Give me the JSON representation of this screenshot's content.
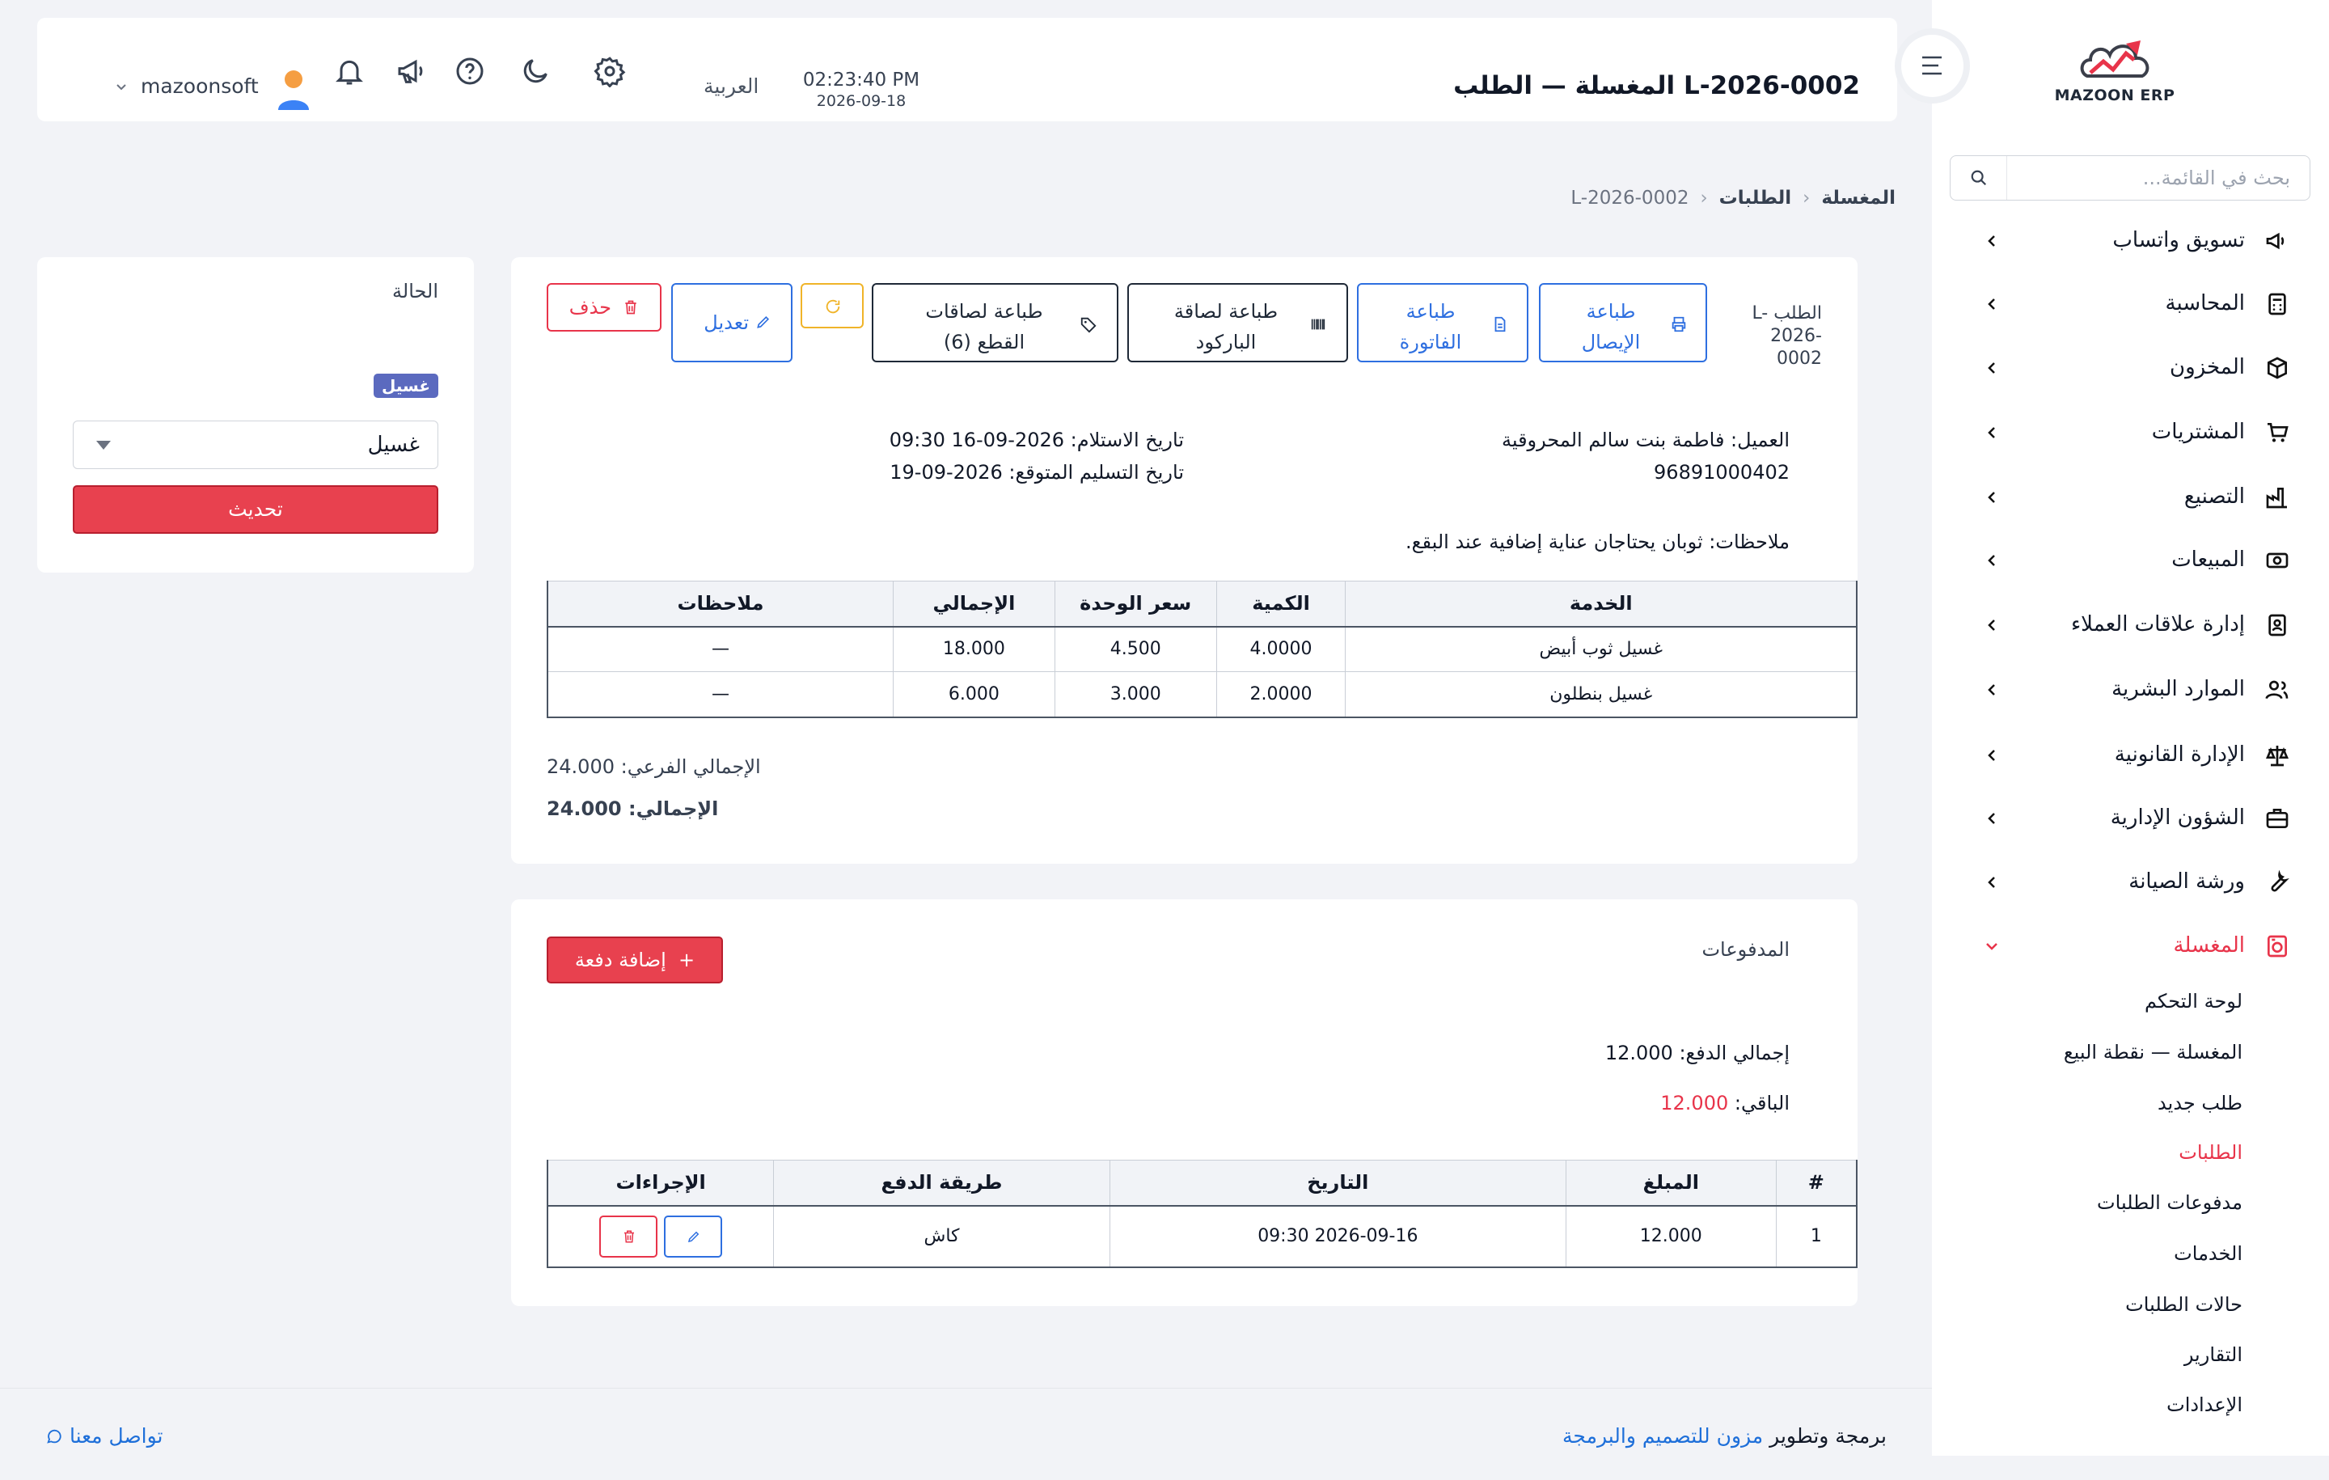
{
  "app": {
    "logo_text": "MAZOON ERP"
  },
  "sidebar": {
    "search_placeholder": "بحث في القائمة...",
    "items": [
      {
        "label": "تسويق واتساب",
        "icon": "megaphone-icon"
      },
      {
        "label": "المحاسبة",
        "icon": "calculator-icon"
      },
      {
        "label": "المخزون",
        "icon": "box-icon"
      },
      {
        "label": "المشتريات",
        "icon": "cart-icon"
      },
      {
        "label": "التصنيع",
        "icon": "factory-icon"
      },
      {
        "label": "المبيعات",
        "icon": "cash-icon"
      },
      {
        "label": "إدارة علاقات العملاء",
        "icon": "contact-book-icon"
      },
      {
        "label": "الموارد البشرية",
        "icon": "users-icon"
      },
      {
        "label": "الإدارة القانونية",
        "icon": "scale-icon"
      },
      {
        "label": "الشؤون الإدارية",
        "icon": "briefcase-icon"
      },
      {
        "label": "ورشة الصيانة",
        "icon": "wrench-icon"
      },
      {
        "label": "المغسلة",
        "icon": "washing-machine-icon",
        "active": true
      }
    ],
    "laundry_sub": [
      {
        "label": "لوحة التحكم"
      },
      {
        "label": "المغسلة — نقطة البيع"
      },
      {
        "label": "طلب جديد"
      },
      {
        "label": "الطلبات",
        "active": true
      },
      {
        "label": "مدفوعات الطلبات"
      },
      {
        "label": "الخدمات"
      },
      {
        "label": "حالات الطلبات"
      },
      {
        "label": "التقارير"
      },
      {
        "label": "الإعدادات"
      }
    ]
  },
  "header": {
    "title": "المغسلة — الطلب L-2026-0002",
    "time": "02:23:40 PM",
    "date": "2026-09-18",
    "language": "العربية",
    "username": "mazoonsoft"
  },
  "breadcrumb": {
    "root": "المغسلة",
    "section": "الطلبات",
    "current": "L-2026-0002"
  },
  "status_card": {
    "label": "الحالة",
    "badge": "غسيل",
    "badge_color": "#5b6abf",
    "selected": "غسيل",
    "update_button": "تحديث"
  },
  "order": {
    "label": "الطلب L-2026-0002",
    "actions": {
      "print_receipt": "طباعة الإيصال",
      "print_invoice": "طباعة الفاتورة",
      "print_barcode": "طباعة لصاقة الباركود",
      "print_labels": "طباعة لصاقات القطع (6)",
      "edit": "تعديل",
      "delete": "حذف"
    },
    "customer": "العميل: فاطمة بنت سالم المحروقية",
    "phone": "96891000402",
    "received": "تاريخ الاستلام: 2026-09-16 09:30",
    "expected": "تاريخ التسليم المتوقع: 2026-09-19",
    "notes": "ملاحظات: ثوبان يحتاجان عناية إضافية عند البقع.",
    "items_headers": [
      "الخدمة",
      "الكمية",
      "سعر الوحدة",
      "الإجمالي",
      "ملاحظات"
    ],
    "items": [
      [
        "غسيل ثوب أبيض",
        "4.0000",
        "4.500",
        "18.000",
        "—"
      ],
      [
        "غسيل بنطلون",
        "2.0000",
        "3.000",
        "6.000",
        "—"
      ]
    ],
    "subtotal": "الإجمالي الفرعي: 24.000",
    "total_label": "الإجمالي:",
    "total_value": "24.000"
  },
  "payments": {
    "title": "المدفوعات",
    "add_button": "إضافة دفعة",
    "paid_total": "إجمالي الدفع: 12.000",
    "remaining_label": "الباقي:",
    "remaining_value": "12.000",
    "remaining_color": "#e8344a",
    "headers": [
      "#",
      "المبلغ",
      "التاريخ",
      "طريقة الدفع",
      "الإجراءات"
    ],
    "rows": [
      [
        "1",
        "12.000",
        "2026-09-16 09:30",
        "كاش"
      ]
    ]
  },
  "footer": {
    "credit_prefix": "برمجة وتطوير",
    "credit_link": "مزون للتصميم والبرمجة",
    "contact": "تواصل معنا"
  }
}
